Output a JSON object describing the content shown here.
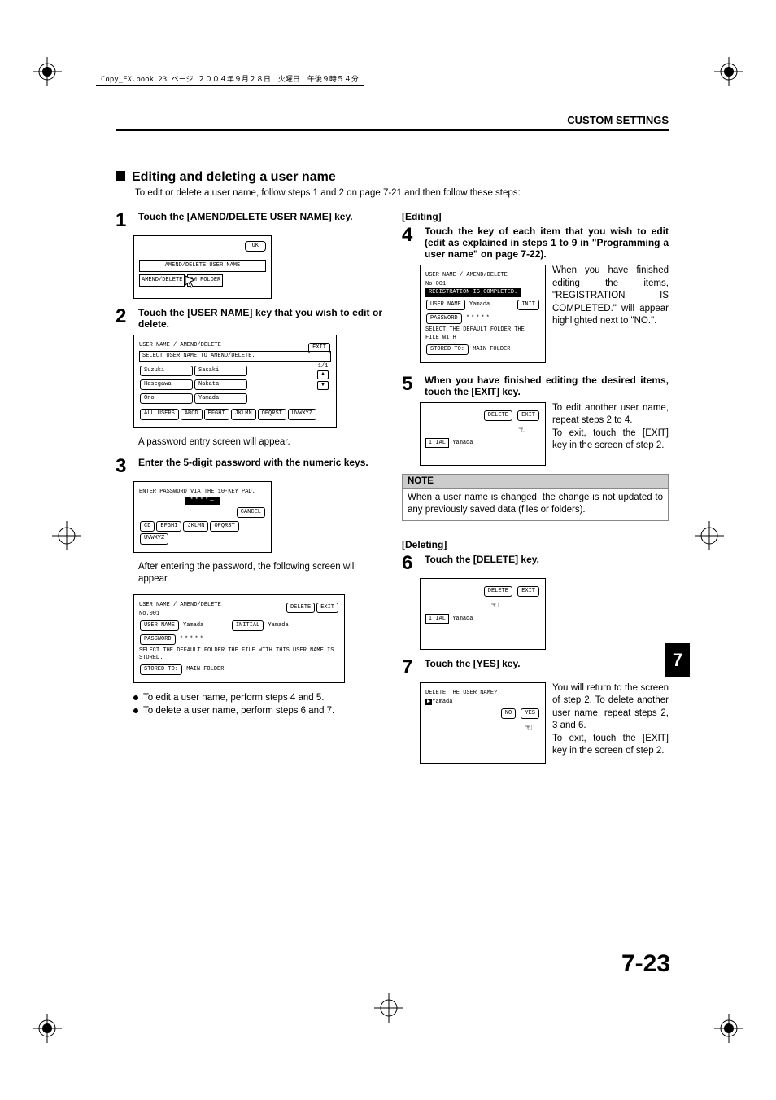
{
  "header_tag": "Copy_EX.book  23 ページ  ２００４年９月２８日　火曜日　午後９時５４分",
  "section_header": "CUSTOM SETTINGS",
  "title": "Editing and deleting a user name",
  "intro": "To edit or delete a user name, follow steps 1 and 2 on page 7-21 and then follow these steps:",
  "left": {
    "s1": {
      "num": "1",
      "title": "Touch the [AMEND/DELETE USER NAME] key.",
      "fig": {
        "ok": "OK",
        "line1": "AMEND/DELETE USER NAME",
        "line2a": "AMEND/DELETE",
        "line2b": "OM FOLDER"
      }
    },
    "s2": {
      "num": "2",
      "title": "Touch the [USER NAME] key that you wish to edit or delete.",
      "fig": {
        "top": "USER NAME / AMEND/DELETE",
        "exit": "EXIT",
        "sel": "SELECT USER NAME TO AMEND/DELETE.",
        "u1a": "Suzuki",
        "u1b": "Sasaki",
        "u2a": "Hasegawa",
        "u2b": "Nakata",
        "u3a": "Ono",
        "u3b": "Yamada",
        "page": "1/1",
        "tabs": [
          "ALL USERS",
          "ABCD",
          "EFGHI",
          "JKLMN",
          "OPQRST",
          "UVWXYZ"
        ]
      },
      "after": "A password entry screen will appear."
    },
    "s3": {
      "num": "3",
      "title": "Enter the 5-digit password with the numeric keys.",
      "fig": {
        "msg": "ENTER PASSWORD VIA THE 10-KEY PAD.",
        "stars": "****—",
        "cancel": "CANCEL",
        "tabs": [
          "CD",
          "EFGHI",
          "JKLMN",
          "OPQRST",
          "UVWXYZ"
        ]
      },
      "after": "After entering the password, the following screen will appear.",
      "fig2": {
        "top": "USER NAME / AMEND/DELETE",
        "delete": "DELETE",
        "exit": "EXIT",
        "no": "No.001",
        "un_lbl": "USER NAME",
        "un_val": "Yamada",
        "init_lbl": "INITIAL",
        "init_val": "Yamada",
        "pw_lbl": "PASSWORD",
        "pw_val": "*****",
        "sel": "SELECT THE DEFAULT FOLDER THE FILE WITH THIS USER NAME IS STORED.",
        "stored": "STORED TO:",
        "folder": "MAIN FOLDER"
      },
      "b1": "To edit a user name, perform steps 4 and 5.",
      "b2": "To delete a user name, perform steps 6 and 7."
    }
  },
  "right": {
    "editing_head": "[Editing]",
    "s4": {
      "num": "4",
      "title": "Touch the key of each item that you wish to edit (edit as explained in steps 1 to 9 in \"Programming a user name\" on page 7-22).",
      "fig": {
        "top": "USER NAME / AMEND/DELETE",
        "no": "No.001",
        "banner": "REGISTRATION IS COMPLETED.",
        "un_lbl": "USER NAME",
        "un_val": "Yamada",
        "init": "INIT",
        "pw_lbl": "PASSWORD",
        "pw_val": "*****",
        "sel": "SELECT THE DEFAULT FOLDER THE FILE WITH",
        "stored": "STORED TO:",
        "folder": "MAIN FOLDER"
      },
      "txt": "When you have finished editing the items, \"REGISTRATION IS COMPLETED.\" will appear highlighted next to \"NO.\"."
    },
    "s5": {
      "num": "5",
      "title": "When you have finished editing the desired items, touch the [EXIT] key.",
      "fig": {
        "delete": "DELETE",
        "exit": "EXIT",
        "itial": "ITIAL",
        "yamada": "Yamada"
      },
      "txt1": "To edit another user name, repeat steps 2 to 4.",
      "txt2": "To exit, touch the [EXIT] key in the screen of step 2."
    },
    "note_head": "NOTE",
    "note_body": "When a user name is changed, the change is not updated to any previously saved data (files or folders).",
    "deleting_head": "[Deleting]",
    "s6": {
      "num": "6",
      "title": "Touch the [DELETE] key.",
      "fig": {
        "delete": "DELETE",
        "exit": "EXIT",
        "itial": "ITIAL",
        "yamada": "Yamada"
      }
    },
    "s7": {
      "num": "7",
      "title": "Touch the [YES] key.",
      "fig": {
        "q": "DELETE THE USER NAME?",
        "name": "Yamada",
        "no": "NO",
        "yes": "YES"
      },
      "txt1": "You will return to the screen of step 2. To delete another user name, repeat steps 2, 3 and 6.",
      "txt2": "To exit, touch the [EXIT] key in the screen of step 2."
    }
  },
  "side_tab": "7",
  "page_num": "7-23"
}
